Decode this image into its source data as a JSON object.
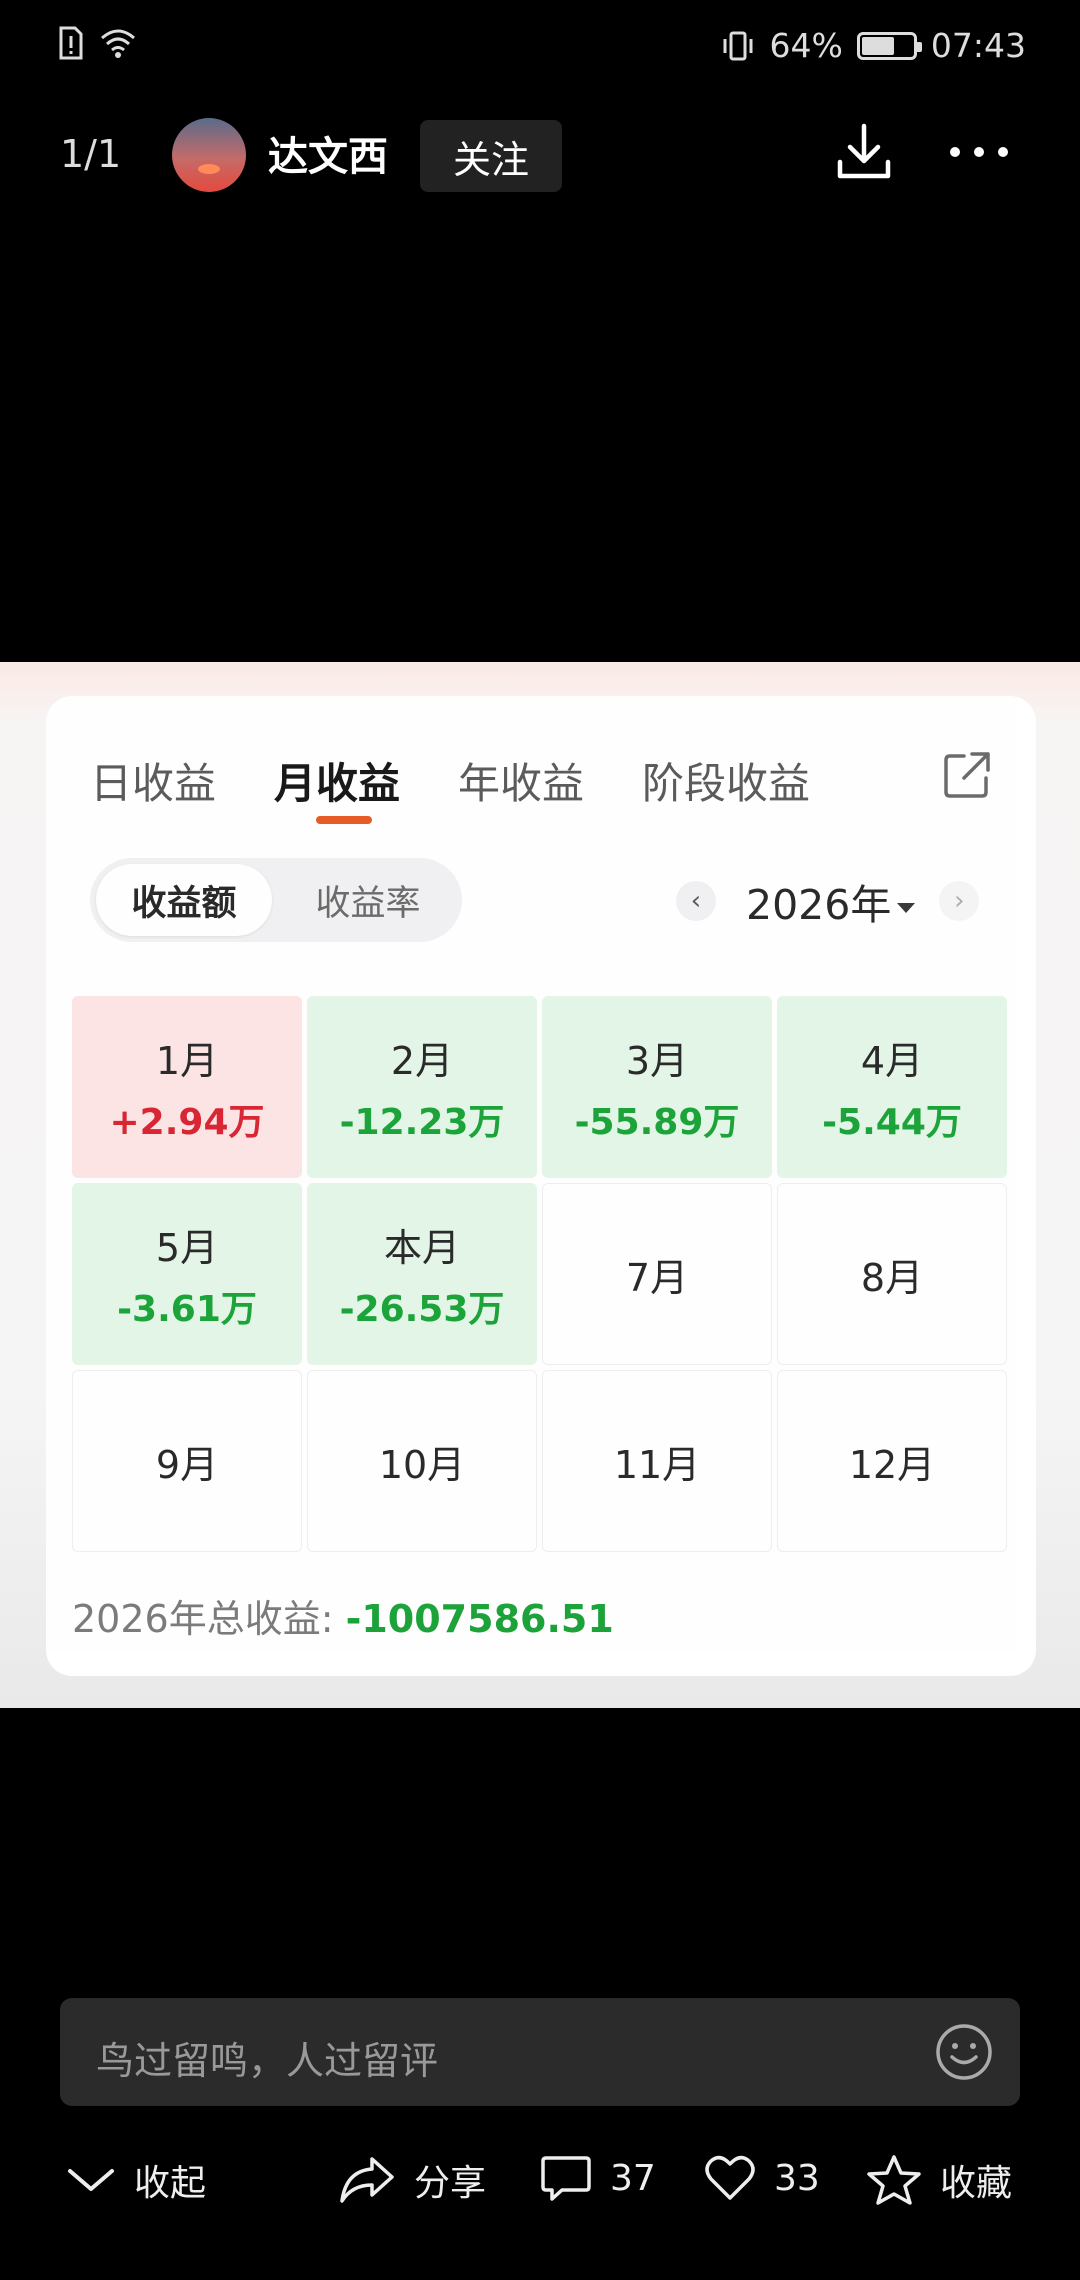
{
  "status_bar": {
    "battery": "64%",
    "battery_level": 0.64,
    "time": "07:43"
  },
  "top_bar": {
    "page_counter": "1/1",
    "username": "达文西",
    "follow_label": "关注"
  },
  "card": {
    "tabs": [
      {
        "label": "日收益",
        "active": false
      },
      {
        "label": "月收益",
        "active": true
      },
      {
        "label": "年收益",
        "active": false
      },
      {
        "label": "阶段收益",
        "active": false
      }
    ],
    "segment": {
      "selected": "收益额",
      "other": "收益率"
    },
    "year_prev": "‹",
    "year": "2026年",
    "year_next": "›",
    "months": [
      {
        "label": "1月",
        "value": "+2.94万",
        "status": "up"
      },
      {
        "label": "2月",
        "value": "-12.23万",
        "status": "down"
      },
      {
        "label": "3月",
        "value": "-55.89万",
        "status": "down"
      },
      {
        "label": "4月",
        "value": "-5.44万",
        "status": "down"
      },
      {
        "label": "5月",
        "value": "-3.61万",
        "status": "down"
      },
      {
        "label": "本月",
        "value": "-26.53万",
        "status": "down"
      },
      {
        "label": "7月",
        "value": "",
        "status": "none"
      },
      {
        "label": "8月",
        "value": "",
        "status": "none"
      },
      {
        "label": "9月",
        "value": "",
        "status": "none"
      },
      {
        "label": "10月",
        "value": "",
        "status": "none"
      },
      {
        "label": "11月",
        "value": "",
        "status": "none"
      },
      {
        "label": "12月",
        "value": "",
        "status": "none"
      }
    ],
    "total_label": "2026年总收益: ",
    "total_value": "-1007586.51"
  },
  "comment": {
    "placeholder": "鸟过留鸣，人过留评"
  },
  "actions": {
    "collapse": "收起",
    "share": "分享",
    "comments": "37",
    "likes": "33",
    "favorite": "收藏"
  },
  "colors": {
    "accent": "#e65620",
    "gain": "#d81e2d",
    "loss": "#14a032"
  }
}
